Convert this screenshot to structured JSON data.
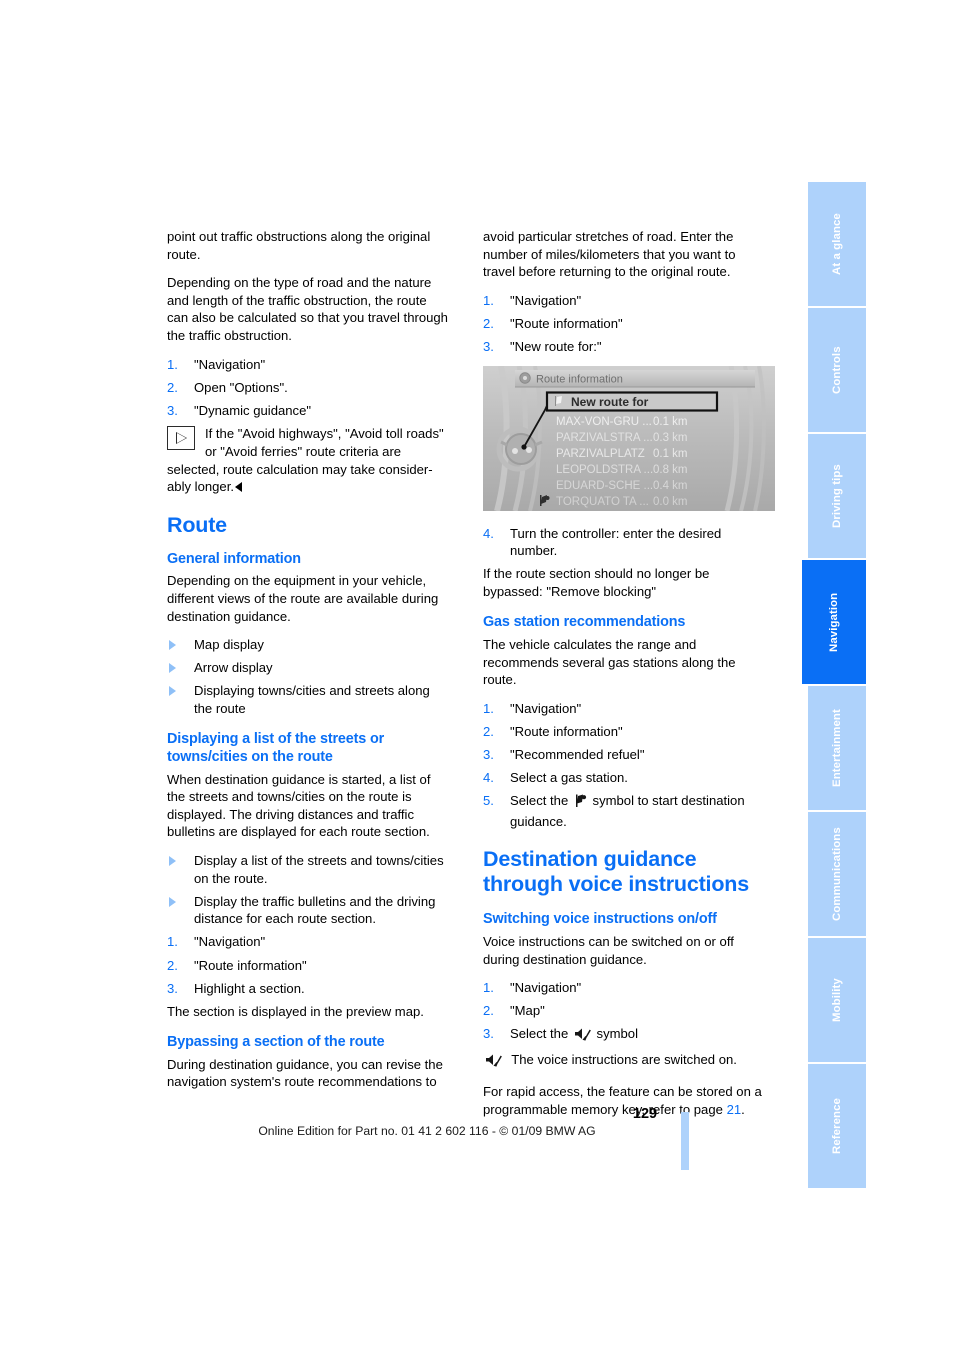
{
  "page": {
    "number": "129",
    "footer_note": "Online Edition for Part no. 01 41 2 602 116 - © 01/09 BMW AG",
    "accent_color": "#0a6ff5",
    "tab_color": "#aed2fb"
  },
  "sidebar": {
    "tabs": [
      {
        "label": "At a glance",
        "active": false
      },
      {
        "label": "Controls",
        "active": false
      },
      {
        "label": "Driving tips",
        "active": false
      },
      {
        "label": "Navigation",
        "active": true
      },
      {
        "label": "Entertainment",
        "active": false
      },
      {
        "label": "Communications",
        "active": false
      },
      {
        "label": "Mobility",
        "active": false
      },
      {
        "label": "Reference",
        "active": false
      }
    ]
  },
  "left_column": {
    "para_continued_1": "point out traffic obstructions along the original route.",
    "para_continued_2": "Depending on the type of road and the nature and length of the traffic obstruction, the route can also be calculated so that you travel through the traffic obstruction.",
    "steps_dynamic": [
      {
        "num": "1.",
        "text": "\"Navigation\""
      },
      {
        "num": "2.",
        "text": "Open \"Options\"."
      },
      {
        "num": "3.",
        "text": "\"Dynamic guidance\""
      }
    ],
    "note_line_1": "If the \"Avoid highways\", \"Avoid toll roads\"",
    "note_line_2": "or \"Avoid ferries\" route criteria are",
    "note_line_3": "selected, route calculation may take consider-",
    "note_line_4": "ably longer.",
    "heading_route": "Route",
    "heading_general_information": "General information",
    "general_info_para": "Depending on the equipment in your vehicle, different views of the route are available during destination guidance.",
    "general_info_bullets": [
      "Map display",
      "Arrow display",
      "Displaying towns/cities and streets along the route"
    ],
    "heading_displaying_list_l1": "Displaying a list of the streets or",
    "heading_displaying_list_l2": "towns/cities on the route",
    "displaying_list_para": "When destination guidance is started, a list of the streets and towns/cities on the route is displayed. The driving distances and traffic bulletins are displayed for each route section.",
    "displaying_list_bullets": [
      "Display a list of the streets and towns/cities on the route.",
      "Display the traffic bulletins and the driving distance for each route section."
    ],
    "displaying_list_steps": [
      {
        "num": "1.",
        "text": "\"Navigation\""
      },
      {
        "num": "2.",
        "text": "\"Route information\""
      },
      {
        "num": "3.",
        "text": "Highlight a section."
      }
    ],
    "preview_para": "The section is displayed in the preview map.",
    "heading_bypassing": "Bypassing a section of the route",
    "bypassing_para": "During destination guidance, you can revise the navigation system's route recommendations to"
  },
  "right_column": {
    "bypassing_continued": "avoid particular stretches of road. Enter the number of miles/kilometers that you want to travel before returning to the original route.",
    "bypassing_steps": [
      {
        "num": "1.",
        "text": "\"Navigation\""
      },
      {
        "num": "2.",
        "text": "\"Route information\""
      },
      {
        "num": "3.",
        "text": "\"New route for:\""
      }
    ],
    "figure": {
      "title": "Route information",
      "highlight_row": "New route for",
      "rows": [
        {
          "name": "MAX-VON-GRU ...",
          "distance": "0.1 km",
          "icon": ""
        },
        {
          "name": "PARZIVALSTRA ...",
          "distance": "0.3 km",
          "icon": ""
        },
        {
          "name": "PARZIVALPLATZ",
          "distance": "0.1 km",
          "icon": ""
        },
        {
          "name": "LEOPOLDSTRA ...",
          "distance": "0.8 km",
          "icon": ""
        },
        {
          "name": "EDUARD-SCHE ...",
          "distance": "0.4 km",
          "icon": ""
        },
        {
          "name": "TORQUATO TA ...",
          "distance": "0.0 km",
          "icon": "flag-icon"
        }
      ]
    },
    "step_4": {
      "num": "4.",
      "text": "Turn the controller: enter the desired number."
    },
    "remove_blocking_para": "If the route section should no longer be bypassed: \"Remove blocking\"",
    "heading_gas_station": "Gas station recommendations",
    "gas_station_para": "The vehicle calculates the range and recommends several gas stations along the route.",
    "gas_station_steps": [
      {
        "num": "1.",
        "text": "\"Navigation\""
      },
      {
        "num": "2.",
        "text": "\"Route information\""
      },
      {
        "num": "3.",
        "text": "\"Recommended refuel\""
      },
      {
        "num": "4.",
        "text": "Select a gas station."
      }
    ],
    "gas_station_step5_pre": "Select the",
    "gas_station_step5_post": "symbol to start destination guidance.",
    "heading_destination_guidance_l1": "Destination guidance",
    "heading_destination_guidance_l2": "through voice instructions",
    "heading_switching_voice": "Switching voice instructions on/off",
    "voice_para": "Voice instructions can be switched on or off during destination guidance.",
    "voice_steps": [
      {
        "num": "1.",
        "text": "\"Navigation\""
      },
      {
        "num": "2.",
        "text": "\"Map\""
      }
    ],
    "voice_step3_pre": "Select the",
    "voice_step3_post": "symbol",
    "voice_status_text": "The voice instructions are switched on.",
    "rapid_access_pre": "For rapid access, the feature can be stored on a programmable memory key, refer to page",
    "rapid_access_page": "21",
    "rapid_access_post": "."
  }
}
